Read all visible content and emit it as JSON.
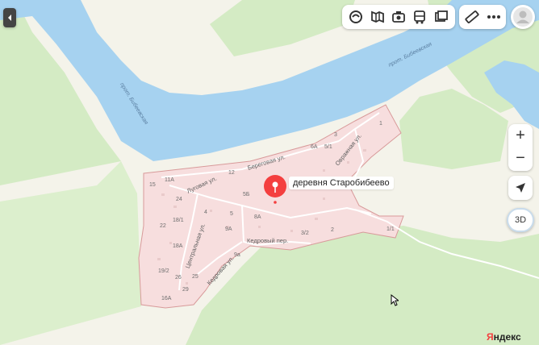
{
  "map": {
    "place_name": "деревня Старобибеево",
    "streets": {
      "beregovaya": "Береговая ул.",
      "lugovaya": "Луговая ул.",
      "ovrazhnaya": "Овражная ул.",
      "tsentralnaya": "Центральная ул.",
      "kedrovaya": "Кедровая ул.",
      "kedrovy_per": "Кедровый пер."
    },
    "channel_left": "прот. Бибеевская",
    "channel_right": "прот. Бибеевская",
    "house_numbers": {
      "n15": "15",
      "n11a": "11А",
      "n24": "24",
      "n12": "12",
      "n18_1": "18/1",
      "n22": "22",
      "n4": "4",
      "n5": "5",
      "n5b": "5Б",
      "n9a": "9А",
      "n8a": "8А",
      "n18a": "18А",
      "n19_2": "19/2",
      "n26": "26",
      "n25": "25",
      "n29": "29",
      "n16a": "16А",
      "n9a_b": "9а",
      "n6a": "6А",
      "n3": "3",
      "n5_1": "5/1",
      "n1": "1",
      "n3_2": "3/2",
      "n2": "2",
      "n1_1": "1/1"
    },
    "brand": "Яндекс",
    "land_color": "#f4f3ea",
    "water_color": "#a6d2f0",
    "forest_color": "#d4ebc4",
    "village_fill": "#f7dede",
    "village_border": "#d89a9a",
    "pin_color": "#f43f3f"
  },
  "controls": {
    "collapse_icon": "chevron-left-icon",
    "zoom_in": "+",
    "zoom_out": "−",
    "view_3d": "3D",
    "tools": [
      "layers-icon",
      "traffic-icon",
      "panorama-icon",
      "transit-icon",
      "photos-icon",
      "ruler-icon",
      "more-icon"
    ]
  }
}
